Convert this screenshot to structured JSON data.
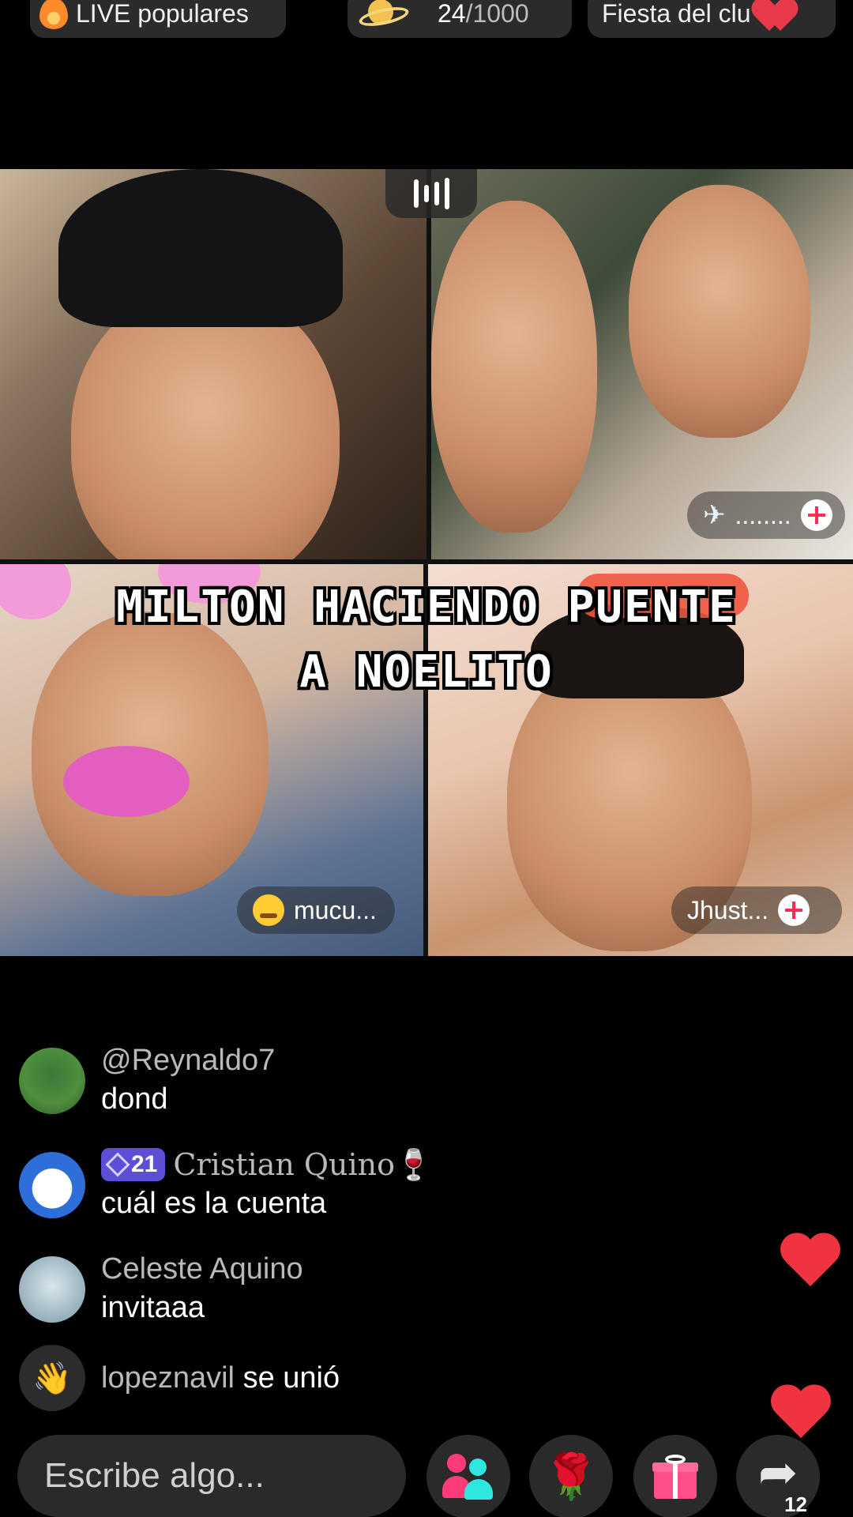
{
  "top_bar": {
    "live_label": "LIVE populares",
    "count_current": "24",
    "count_total": "/1000",
    "event_label": "Fiesta del clu"
  },
  "grid": {
    "tile2_tag": "........",
    "tile3_tag": "mucu...",
    "tile4_tag": "Jhust..."
  },
  "overlay_caption": {
    "line1": "MILTON HACIENDO PUENTE",
    "line2": "A NOELITO"
  },
  "chat": {
    "messages": [
      {
        "name": "@Reynaldo7",
        "text": "dond"
      },
      {
        "level": "21",
        "name": "Cristian Quino🍷",
        "text": "cuál es la cuenta"
      },
      {
        "name": "Celeste Aquino",
        "text": "invitaaa"
      }
    ],
    "join": {
      "name": "lopeznavil",
      "text": "se unió",
      "icon": "👋"
    }
  },
  "bottom_bar": {
    "input_placeholder": "Escribe algo...",
    "share_count": "12",
    "rose_glyph": "🌹",
    "share_glyph": "➦"
  },
  "colors": {
    "accent_pink": "#ff3b7a",
    "accent_cyan": "#2ee8e0",
    "heart_red": "#ef3340",
    "level_badge": "#5a4fd6"
  }
}
